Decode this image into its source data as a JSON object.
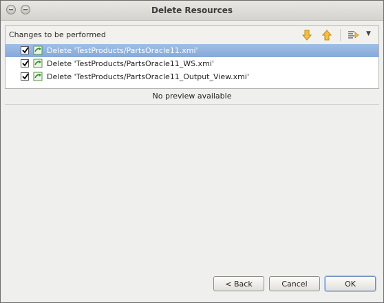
{
  "window": {
    "title": "Delete Resources"
  },
  "changes": {
    "header_label": "Changes to be performed",
    "toolbar": {
      "next_icon": "arrow-down-icon",
      "prev_icon": "arrow-up-icon",
      "filter_icon": "filter-icon",
      "menu_icon": "chevron-down-icon"
    },
    "items": [
      {
        "label": "Delete 'TestProducts/PartsOracle11.xmi'",
        "checked": true,
        "selected": true
      },
      {
        "label": "Delete 'TestProducts/PartsOracle11_WS.xmi'",
        "checked": true,
        "selected": false
      },
      {
        "label": "Delete 'TestProducts/PartsOracle11_Output_View.xmi'",
        "checked": true,
        "selected": false
      }
    ]
  },
  "preview": {
    "message": "No preview available"
  },
  "buttons": {
    "back": "< Back",
    "cancel": "Cancel",
    "ok": "OK"
  },
  "colors": {
    "selection": "#8fb0dc",
    "arrow_icons": "#e8a317",
    "change_icon": "#3a9a3a"
  }
}
